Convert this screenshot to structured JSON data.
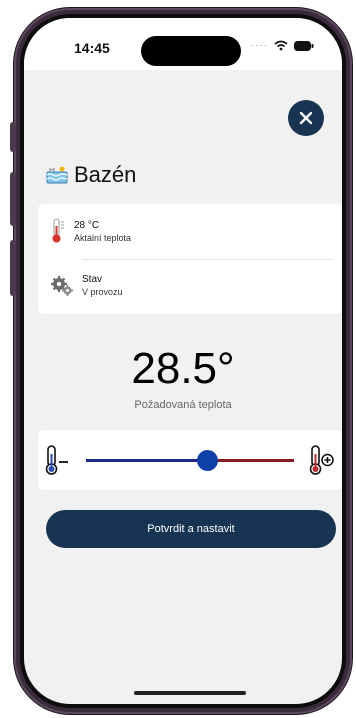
{
  "status_bar": {
    "time": "14:45"
  },
  "header": {
    "title": "Bazén",
    "close_icon": "close-icon"
  },
  "info": {
    "temperature": {
      "value": "28 °C",
      "label": "Aktální teplota",
      "icon": "thermometer-icon"
    },
    "state": {
      "value": "Stav",
      "label": "V provozu",
      "icon": "gears-icon"
    }
  },
  "setpoint": {
    "value": "28.5°",
    "label": "Požadovaná teplota",
    "slider_fraction": 0.58
  },
  "actions": {
    "confirm_label": "Potvrdit a nastavit"
  },
  "colors": {
    "primary": "#173553",
    "cold": "#1e2a8c",
    "hot": "#8a1a22"
  }
}
